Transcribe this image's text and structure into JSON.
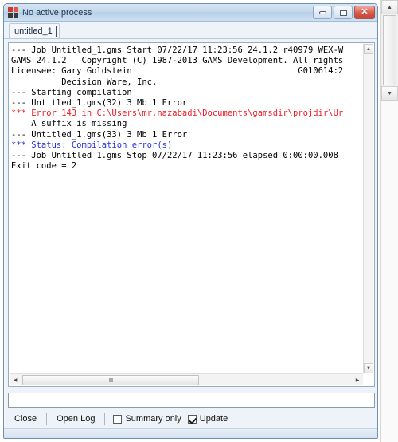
{
  "window": {
    "title": "No active process",
    "icon": "gams-app-icon",
    "buttons": {
      "minimize_label": "–",
      "maximize_label": "□",
      "close_label": "✕"
    }
  },
  "tabs": [
    {
      "label": "untitled_1",
      "active": true
    }
  ],
  "log": {
    "lines": [
      {
        "text": "--- Job Untitled_1.gms Start 07/22/17 11:23:56 24.1.2 r40979 WEX-W",
        "style": "normal"
      },
      {
        "text": "GAMS 24.1.2   Copyright (C) 1987-2013 GAMS Development. All rights",
        "style": "normal"
      },
      {
        "text": "Licensee: Gary Goldstein                                 G010614:2",
        "style": "normal"
      },
      {
        "text": "          Decision Ware, Inc.",
        "style": "normal"
      },
      {
        "text": "--- Starting compilation",
        "style": "normal"
      },
      {
        "text": "--- Untitled_1.gms(32) 3 Mb 1 Error",
        "style": "normal"
      },
      {
        "text": "*** Error 143 in C:\\Users\\mr.nazabadi\\Documents\\gamsdir\\projdir\\Ur",
        "style": "error"
      },
      {
        "text": "    A suffix is missing",
        "style": "normal"
      },
      {
        "text": "--- Untitled_1.gms(33) 3 Mb 1 Error",
        "style": "normal"
      },
      {
        "text": "*** Status: Compilation error(s)",
        "style": "status"
      },
      {
        "text": "--- Job Untitled_1.gms Stop 07/22/17 11:23:56 elapsed 0:00:00.008",
        "style": "normal"
      },
      {
        "text": "Exit code = 2",
        "style": "normal"
      }
    ]
  },
  "command_input": {
    "value": "",
    "placeholder": ""
  },
  "bottom_bar": {
    "close_label": "Close",
    "open_log_label": "Open Log",
    "summary_only_label": "Summary only",
    "summary_only_checked": false,
    "update_label": "Update",
    "update_checked": true
  },
  "scrollbars": {
    "inner_vertical_up": "▲",
    "inner_vertical_down": "▼",
    "inner_horizontal_left": "◀",
    "inner_horizontal_right": "▶",
    "outer_up": "▲",
    "outer_down": "▼"
  },
  "colors": {
    "error_text": "#ee1c25",
    "status_text": "#2430dd",
    "normal_text": "#000000",
    "titlebar": "#c3d8ec",
    "window_border": "#6d8fb3",
    "close_button": "#c54434"
  }
}
